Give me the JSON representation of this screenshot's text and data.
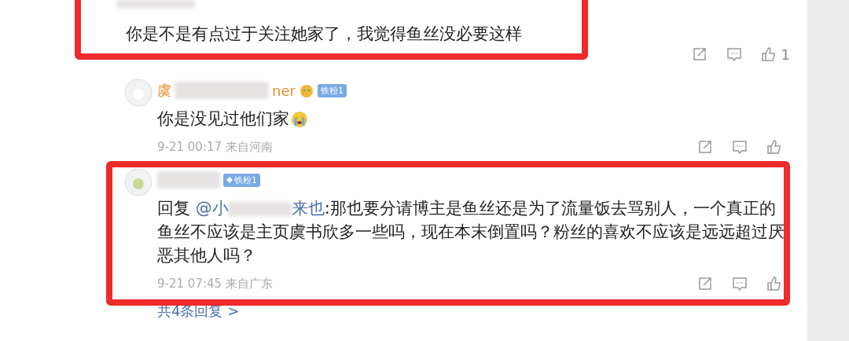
{
  "comment": {
    "text": "你是不是有点过于关注她家了，我觉得鱼丝没必要这样",
    "likes": "1"
  },
  "replies": [
    {
      "kind": "plain",
      "name_start": "虞",
      "name_end": "ner",
      "badge": "铁粉1",
      "text": "你是没见过他们家",
      "time": "9-21 00:17 来自河南"
    },
    {
      "kind": "reply",
      "badge": "铁粉1",
      "reply_prefix": "回复",
      "mention_start": "@小",
      "mention_end": "来也",
      "text": ":那也要分请博主是鱼丝还是为了流量饭去骂别人，一个真正的鱼丝不应该是主页虞书欣多一些吗，现在本末倒置吗？粉丝的喜欢不应该是远远超过厌恶其他人吗？",
      "time": "9-21 07:45 来自广东"
    }
  ],
  "more_replies": "共4条回复 >"
}
